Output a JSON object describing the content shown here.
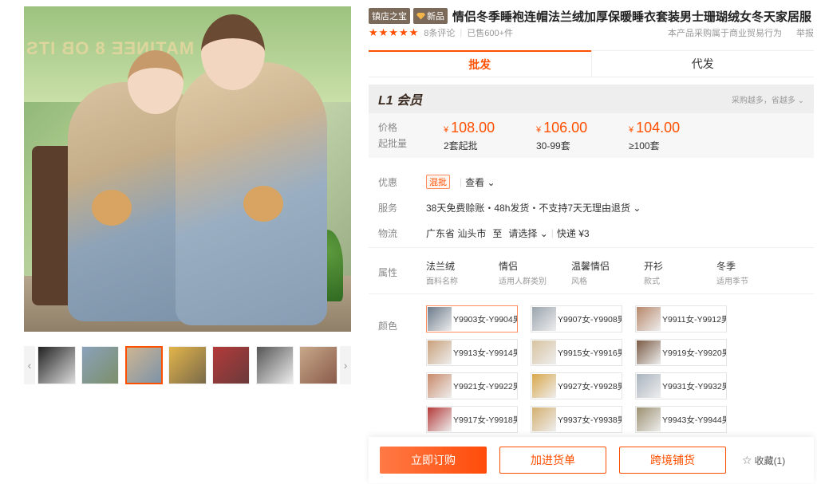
{
  "gallery": {
    "main_image_text": "MATINEE 8 OB ITS",
    "thumbnails": [
      {
        "colors": [
          "#222",
          "#ddd"
        ]
      },
      {
        "colors": [
          "#8aa2bb",
          "#7c8f6a"
        ]
      },
      {
        "colors": [
          "#cdb592",
          "#7d93a9"
        ],
        "active": true
      },
      {
        "colors": [
          "#e2b54a",
          "#7a6a4a"
        ]
      },
      {
        "colors": [
          "#b43a3a",
          "#6a3a3a"
        ]
      },
      {
        "colors": [
          "#555",
          "#eee"
        ]
      },
      {
        "colors": [
          "#c7a98a",
          "#8a5a4a"
        ]
      }
    ],
    "prev_icon": "‹",
    "next_icon": "›"
  },
  "product": {
    "store_badge": "镇店之宝",
    "new_badge": "新品",
    "title": "情侣冬季睡袍连帽法兰绒加厚保暖睡衣套装男士珊瑚绒女冬天家居服",
    "stars": "★★★★★",
    "reviews": "8条评论",
    "sold": "已售600+件",
    "business_note": "本产品采购属于商业贸易行为",
    "report": "举报"
  },
  "tabs": {
    "wholesale": "批发",
    "dropship": "代发"
  },
  "pricing": {
    "member_level": "L1 会员",
    "more_tip": "采购越多，省越多 ⌄",
    "price_label": "价格",
    "moq_label": "起批量",
    "currency": "¥",
    "tiers": [
      {
        "price": "108.00",
        "qty": "2套起批"
      },
      {
        "price": "106.00",
        "qty": "30-99套"
      },
      {
        "price": "104.00",
        "qty": "≥100套"
      }
    ]
  },
  "details": {
    "discount_label": "优惠",
    "discount_tag": "混批",
    "discount_view": "查看 ⌄",
    "service_label": "服务",
    "service_text": "38天免费赊账・48h发货・不支持7天无理由退货 ⌄",
    "logistics_label": "物流",
    "origin": "广东省 汕头市",
    "to": "至",
    "dest": "请选择 ⌄",
    "ship": "快递 ¥3"
  },
  "attributes": {
    "label": "属性",
    "items": [
      {
        "value": "法兰绒",
        "key": "面料名称"
      },
      {
        "value": "情侣",
        "key": "适用人群类别"
      },
      {
        "value": "温馨情侣",
        "key": "风格"
      },
      {
        "value": "开衫",
        "key": "款式"
      },
      {
        "value": "冬季",
        "key": "适用季节"
      }
    ]
  },
  "color_options": {
    "label": "颜色",
    "items": [
      {
        "name": "Y9903女-Y9904男",
        "swatch": "#6b7a8a",
        "selected": true
      },
      {
        "name": "Y9907女-Y9908男",
        "swatch": "#9aa4ae"
      },
      {
        "name": "Y9911女-Y9912男",
        "swatch": "#b7876a"
      },
      {
        "name": "Y9913女-Y9914男",
        "swatch": "#c9a07a"
      },
      {
        "name": "Y9915女-Y9916男",
        "swatch": "#d8c3a0"
      },
      {
        "name": "Y9919女-Y9920男",
        "swatch": "#7a5a44"
      },
      {
        "name": "Y9921女-Y9922男",
        "swatch": "#c98a6a"
      },
      {
        "name": "Y9927女-Y9928男",
        "swatch": "#d9a84a"
      },
      {
        "name": "Y9931女-Y9932男",
        "swatch": "#a9b4bf"
      },
      {
        "name": "Y9917女-Y9918男",
        "swatch": "#b43a3a"
      },
      {
        "name": "Y9937女-Y9938男",
        "swatch": "#d4b070"
      },
      {
        "name": "Y9943女-Y9944男",
        "swatch": "#9c9070"
      }
    ]
  },
  "actions": {
    "order": "立即订购",
    "add_list": "加进货单",
    "cross_border": "跨境铺货",
    "favorite_icon": "☆",
    "favorite": "收藏(1)"
  },
  "colors": {
    "accent": "#ff5000"
  }
}
